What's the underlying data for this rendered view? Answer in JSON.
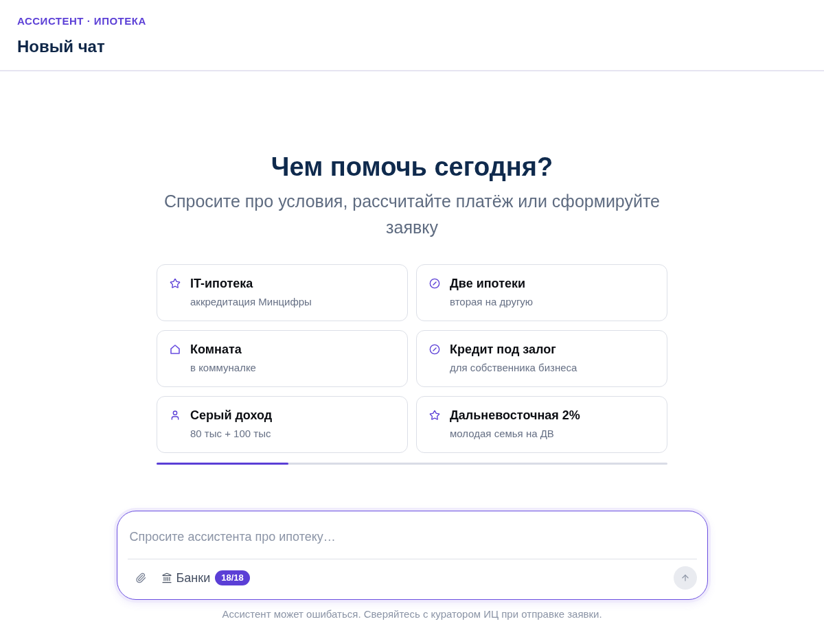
{
  "header": {
    "eyebrow": "АССИСТЕНТ · ИПОТЕКА",
    "title": "Новый чат"
  },
  "welcome": {
    "heading": "Чем помочь сегодня?",
    "subtitle": "Спросите про условия, рассчитайте платёж или сформируйте заявку"
  },
  "suggestions": [
    {
      "kind": "star",
      "title": "IT-ипотека",
      "subtitle": "аккредитация Минцифры"
    },
    {
      "kind": "ban",
      "title": "Две ипотеки",
      "subtitle": "вторая на другую"
    },
    {
      "kind": "home",
      "title": "Комната",
      "subtitle": "в коммуналке"
    },
    {
      "kind": "ban",
      "title": "Кредит под залог",
      "subtitle": "для собственника бизнеса"
    },
    {
      "kind": "person",
      "title": "Серый доход",
      "subtitle": "80 тыс + 100 тыс"
    },
    {
      "kind": "star",
      "title": "Дальневосточная 2%",
      "subtitle": "молодая семья на ДВ"
    }
  ],
  "composer": {
    "placeholder": "Спросите ассистента про ипотеку…",
    "banks_button": {
      "label": "Банки",
      "badge": "18/18"
    },
    "send_button": {
      "disabled": true
    }
  },
  "disclaimer": "Ассистент может ошибаться. Сверяйтесь с куратором ИЦ при отправке заявки."
}
